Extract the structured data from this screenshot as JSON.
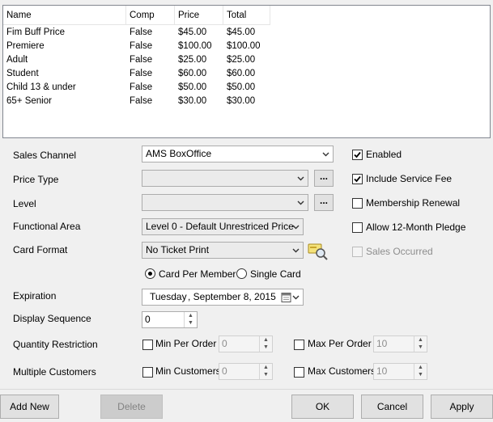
{
  "grid": {
    "columns": [
      "Name",
      "Comp",
      "Price",
      "Total"
    ],
    "rows": [
      [
        "Fim Buff Price",
        "False",
        "$45.00",
        "$45.00"
      ],
      [
        "Premiere",
        "False",
        "$100.00",
        "$100.00"
      ],
      [
        "Adult",
        "False",
        "$25.00",
        "$25.00"
      ],
      [
        "Student",
        "False",
        "$60.00",
        "$60.00"
      ],
      [
        "Child 13 & under",
        "False",
        "$50.00",
        "$50.00"
      ],
      [
        "65+ Senior",
        "False",
        "$30.00",
        "$30.00"
      ]
    ]
  },
  "labels": {
    "sales_channel": "Sales Channel",
    "price_type": "Price Type",
    "level": "Level",
    "functional_area": "Functional Area",
    "card_format": "Card Format",
    "expiration": "Expiration",
    "display_sequence": "Display Sequence",
    "quantity_restriction": "Quantity Restriction",
    "multiple_customers": "Multiple Customers"
  },
  "fields": {
    "sales_channel": "AMS BoxOffice",
    "price_type": "",
    "level": "",
    "functional_area": "Level 0 - Default Unrestriced Price",
    "card_format": "No Ticket Print",
    "ellipsis": "...",
    "expiration_day": "Tuesday",
    "expiration_date": ", September  8, 2015",
    "display_sequence": "0",
    "min_per_order": "0",
    "max_per_order": "10",
    "min_customers": "0",
    "max_customers": "10"
  },
  "radios": {
    "card_per_member": "Card Per Member",
    "single_card": "Single Card",
    "selected": "card_per_member"
  },
  "checkboxes": {
    "enabled": {
      "label": "Enabled",
      "checked": true
    },
    "include_service_fee": {
      "label": "Include Service Fee",
      "checked": true
    },
    "membership_renewal": {
      "label": "Membership Renewal",
      "checked": false
    },
    "allow_12_month_pledge": {
      "label": "Allow 12-Month Pledge",
      "checked": false
    },
    "sales_occurred": {
      "label": "Sales Occurred",
      "checked": false,
      "disabled": true
    },
    "min_per_order": {
      "label": "Min Per Order",
      "checked": false
    },
    "max_per_order": {
      "label": "Max Per Order",
      "checked": false
    },
    "min_customers": {
      "label": "Min Customers",
      "checked": false
    },
    "max_customers": {
      "label": "Max Customers",
      "checked": false
    }
  },
  "buttons": {
    "add_new": "Add New",
    "delete": "Delete",
    "ok": "OK",
    "cancel": "Cancel",
    "apply": "Apply"
  },
  "icons": {
    "card_format_preview": "magnifier-card-icon",
    "calendar": "calendar-icon",
    "dropdown": "chevron-down-icon"
  }
}
